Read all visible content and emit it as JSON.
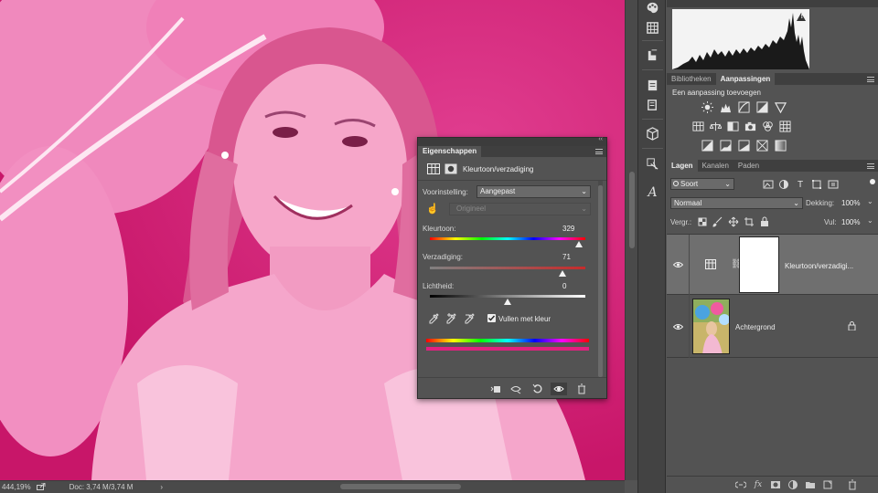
{
  "status": {
    "zoom": "444,19%",
    "doc": "Doc: 3,74 M/3,74 M"
  },
  "tools": [
    "palette-icon",
    "grid-icon",
    "fill-handle-icon",
    "notes-icon",
    "copy-icon",
    "cube-icon",
    "text-on-path-icon",
    "type-style-icon"
  ],
  "histogram": {
    "warning": "!"
  },
  "libraries_panel": {
    "tabs": [
      "Bibliotheken",
      "Aanpassingen"
    ],
    "active_tab": "Aanpassingen",
    "heading": "Een aanpassing toevoegen"
  },
  "layers_panel": {
    "tabs": [
      "Lagen",
      "Kanalen",
      "Paden"
    ],
    "active_tab": "Lagen",
    "filter": "Soort",
    "blend_mode": "Normaal",
    "opacity_label": "Dekking:",
    "opacity_value": "100%",
    "lock_label": "Vergr.:",
    "fill_label": "Vul:",
    "fill_value": "100%",
    "layers": [
      {
        "name": "Kleurtoon/verzadigi...",
        "type": "adjustment",
        "visible": true,
        "selected": true
      },
      {
        "name": "Achtergrond",
        "type": "image",
        "visible": true,
        "locked": true
      }
    ]
  },
  "properties_panel": {
    "tab": "Eigenschappen",
    "title": "Kleurtoon/verzadiging",
    "preset_label": "Voorinstelling:",
    "preset_value": "Aangepast",
    "channel_value": "Origineel",
    "hue_label": "Kleurtoon:",
    "hue_value": "329",
    "hue_fraction": 0.957,
    "saturation_label": "Verzadiging:",
    "saturation_value": "71",
    "saturation_fraction": 0.855,
    "lightness_label": "Lichtheid:",
    "lightness_value": "0",
    "lightness_fraction": 0.5,
    "colorize_label": "Vullen met kleur",
    "colorize_checked": true
  },
  "colors": {
    "tint": "#e2207f",
    "panel": "#535353",
    "dark": "#3f3f3f"
  }
}
